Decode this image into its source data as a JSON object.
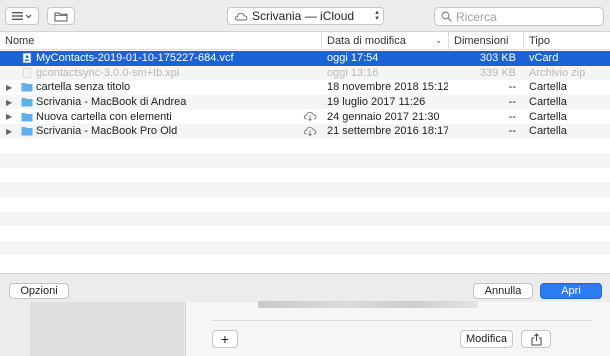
{
  "toolbar": {
    "view_icon": "list-view-icon",
    "new_folder_icon": "new-folder-icon",
    "location_label": "Scrivania — iCloud",
    "search_placeholder": "Ricerca"
  },
  "columns": {
    "name": "Nome",
    "date": "Data di modifica",
    "size": "Dimensioni",
    "kind": "Tipo"
  },
  "files": [
    {
      "name": "MyContacts-2019-01-10-175227-684.vcf",
      "date": "oggi 17:54",
      "size": "303 KB",
      "kind": "vCard",
      "icon": "vcard-file-icon",
      "folder": false,
      "selected": true,
      "disabled": false,
      "cloud": false
    },
    {
      "name": "gcontactsync-3.0.0-sm+tb.xpi",
      "date": "oggi 13:16",
      "size": "339 KB",
      "kind": "Archivio zip",
      "icon": "zip-file-icon",
      "folder": false,
      "selected": false,
      "disabled": true,
      "cloud": false
    },
    {
      "name": "cartella senza titolo",
      "date": "18 novembre 2018 15:12",
      "size": "--",
      "kind": "Cartella",
      "icon": "folder-icon",
      "folder": true,
      "selected": false,
      "disabled": false,
      "cloud": false
    },
    {
      "name": "Scrivania - MacBook di Andrea",
      "date": "19 luglio 2017 11:26",
      "size": "--",
      "kind": "Cartella",
      "icon": "folder-icon",
      "folder": true,
      "selected": false,
      "disabled": false,
      "cloud": false
    },
    {
      "name": "Nuova cartella con elementi",
      "date": "24 gennaio 2017 21:30",
      "size": "--",
      "kind": "Cartella",
      "icon": "folder-icon",
      "folder": true,
      "selected": false,
      "disabled": false,
      "cloud": true
    },
    {
      "name": "Scrivania - MacBook Pro Old",
      "date": "21 settembre 2016 18:17",
      "size": "--",
      "kind": "Cartella",
      "icon": "folder-icon",
      "folder": true,
      "selected": false,
      "disabled": false,
      "cloud": true
    }
  ],
  "buttons": {
    "options": "Opzioni",
    "cancel": "Annulla",
    "open": "Apri"
  },
  "background_window": {
    "add_label": "+",
    "edit_label": "Modifica",
    "share_icon": "share-icon"
  },
  "colors": {
    "selection": "#1a63d6",
    "primary_button": "#2b7cf2",
    "folder": "#5fb0ea"
  }
}
